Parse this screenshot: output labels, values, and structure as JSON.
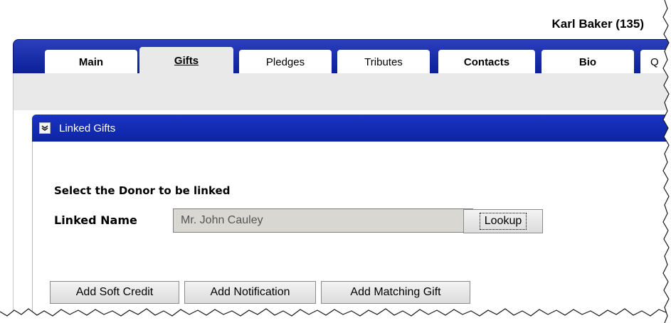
{
  "header": {
    "record_name": "Karl Baker (135)"
  },
  "tabs": [
    {
      "label": "Main",
      "bold": true,
      "active": false
    },
    {
      "label": "Gifts",
      "bold": true,
      "active": true
    },
    {
      "label": "Pledges",
      "bold": false,
      "active": false
    },
    {
      "label": "Tributes",
      "bold": false,
      "active": false
    },
    {
      "label": "Contacts",
      "bold": true,
      "active": false
    },
    {
      "label": "Bio",
      "bold": true,
      "active": false
    },
    {
      "label": "Q",
      "bold": false,
      "active": false
    }
  ],
  "panel": {
    "title": "Linked Gifts",
    "toggle_icon": "chevron-down-icon"
  },
  "form": {
    "section_title": "Select the Donor to be linked",
    "linked_name_label": "Linked Name",
    "linked_name_value": "Mr. John Cauley",
    "lookup_label": "Lookup"
  },
  "actions": {
    "soft_credit_label": "Add Soft Credit",
    "notification_label": "Add Notification",
    "matching_gift_label": "Add Matching Gift"
  },
  "colors": {
    "tabbar_blue": "#0a1f98",
    "panel_header_blue": "#1c34bf",
    "subbar_gray": "#e9e9e9",
    "input_bg": "#d9d7d1"
  }
}
